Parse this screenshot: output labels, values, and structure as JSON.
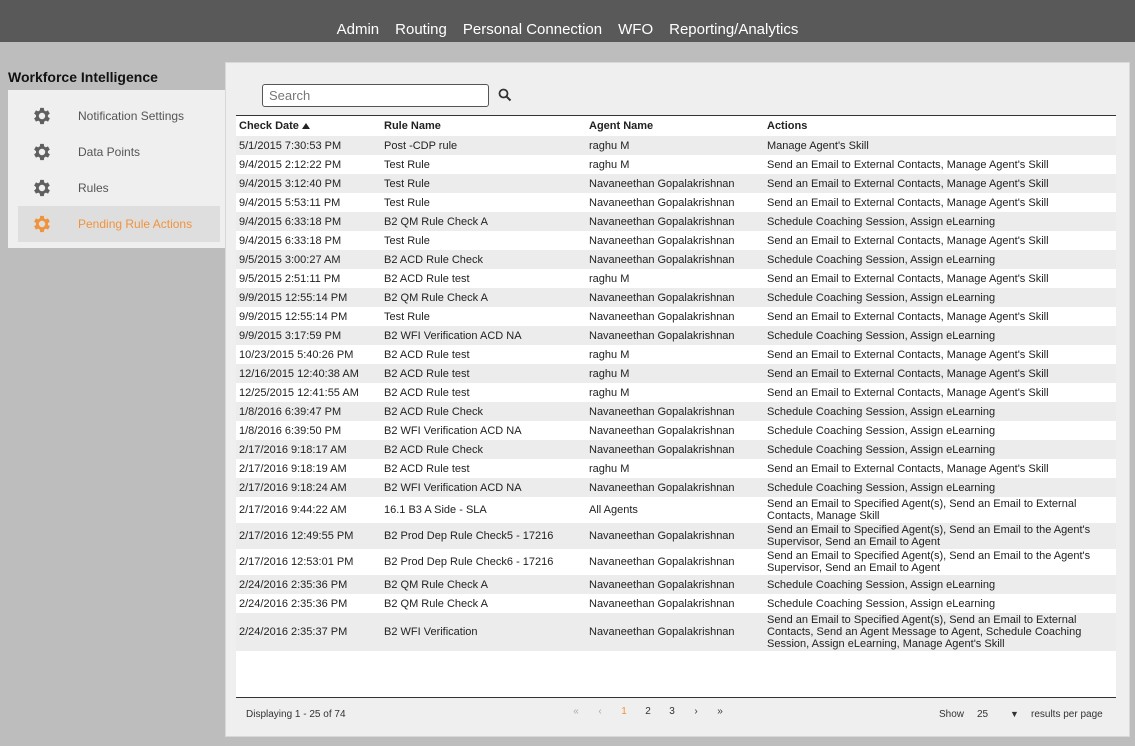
{
  "topnav": [
    "Admin",
    "Routing",
    "Personal Connection",
    "WFO",
    "Reporting/Analytics"
  ],
  "sidebar": {
    "title": "Workforce Intelligence",
    "items": [
      {
        "label": "Notification Settings",
        "icon": "gear-icon"
      },
      {
        "label": "Data Points",
        "icon": "gear-icon"
      },
      {
        "label": "Rules",
        "icon": "gear-icon"
      },
      {
        "label": "Pending Rule Actions",
        "icon": "gear-icon",
        "active": true
      }
    ]
  },
  "colors": {
    "accent": "#f0933f",
    "topbar": "#595959"
  },
  "search": {
    "placeholder": "Search",
    "icon": "magnifier-icon"
  },
  "table": {
    "columns": [
      "Check Date",
      "Rule Name",
      "Agent Name",
      "Actions"
    ],
    "sorted_by": "Check Date",
    "rows": [
      [
        "5/1/2015 7:30:53 PM",
        "Post -CDP rule",
        "raghu M",
        "Manage Agent's Skill"
      ],
      [
        "9/4/2015 2:12:22 PM",
        "Test Rule",
        "raghu M",
        "Send an Email to External Contacts, Manage Agent's Skill"
      ],
      [
        "9/4/2015 3:12:40 PM",
        "Test Rule",
        "Navaneethan Gopalakrishnan",
        "Send an Email to External Contacts, Manage Agent's Skill"
      ],
      [
        "9/4/2015 5:53:11 PM",
        "Test Rule",
        "Navaneethan Gopalakrishnan",
        "Send an Email to External Contacts, Manage Agent's Skill"
      ],
      [
        "9/4/2015 6:33:18 PM",
        "B2 QM Rule Check A",
        "Navaneethan Gopalakrishnan",
        "Schedule Coaching Session, Assign eLearning"
      ],
      [
        "9/4/2015 6:33:18 PM",
        "Test Rule",
        "Navaneethan Gopalakrishnan",
        "Send an Email to External Contacts, Manage Agent's Skill"
      ],
      [
        "9/5/2015 3:00:27 AM",
        "B2 ACD Rule Check",
        "Navaneethan Gopalakrishnan",
        "Schedule Coaching Session, Assign eLearning"
      ],
      [
        "9/5/2015 2:51:11 PM",
        "B2 ACD Rule test",
        "raghu M",
        "Send an Email to External Contacts, Manage Agent's Skill"
      ],
      [
        "9/9/2015 12:55:14 PM",
        "B2 QM Rule Check A",
        "Navaneethan Gopalakrishnan",
        "Schedule Coaching Session, Assign eLearning"
      ],
      [
        "9/9/2015 12:55:14 PM",
        "Test Rule",
        "Navaneethan Gopalakrishnan",
        "Send an Email to External Contacts, Manage Agent's Skill"
      ],
      [
        "9/9/2015 3:17:59 PM",
        "B2 WFI Verification ACD NA",
        "Navaneethan Gopalakrishnan",
        "Schedule Coaching Session, Assign eLearning"
      ],
      [
        "10/23/2015 5:40:26 PM",
        "B2 ACD Rule test",
        "raghu M",
        "Send an Email to External Contacts, Manage Agent's Skill"
      ],
      [
        "12/16/2015 12:40:38 AM",
        "B2 ACD Rule test",
        "raghu M",
        "Send an Email to External Contacts, Manage Agent's Skill"
      ],
      [
        "12/25/2015 12:41:55 AM",
        "B2 ACD Rule test",
        "raghu M",
        "Send an Email to External Contacts, Manage Agent's Skill"
      ],
      [
        "1/8/2016 6:39:47 PM",
        "B2 ACD Rule Check",
        "Navaneethan Gopalakrishnan",
        "Schedule Coaching Session, Assign eLearning"
      ],
      [
        "1/8/2016 6:39:50 PM",
        "B2 WFI Verification ACD NA",
        "Navaneethan Gopalakrishnan",
        "Schedule Coaching Session, Assign eLearning"
      ],
      [
        "2/17/2016 9:18:17 AM",
        "B2 ACD Rule Check",
        "Navaneethan Gopalakrishnan",
        "Schedule Coaching Session, Assign eLearning"
      ],
      [
        "2/17/2016 9:18:19 AM",
        "B2 ACD Rule test",
        "raghu M",
        "Send an Email to External Contacts, Manage Agent's Skill"
      ],
      [
        "2/17/2016 9:18:24 AM",
        "B2 WFI Verification ACD NA",
        "Navaneethan Gopalakrishnan",
        "Schedule Coaching Session, Assign eLearning"
      ],
      [
        "2/17/2016 9:44:22 AM",
        "16.1 B3 A Side - SLA",
        "All Agents",
        "Send an Email to Specified Agent(s), Send an Email to External Contacts, Manage Skill"
      ],
      [
        "2/17/2016 12:49:55 PM",
        "B2 Prod Dep Rule Check5 - 17216",
        "Navaneethan Gopalakrishnan",
        "Send an Email to Specified Agent(s), Send an Email to the Agent's Supervisor, Send an Email to Agent"
      ],
      [
        "2/17/2016 12:53:01 PM",
        "B2 Prod Dep Rule Check6 - 17216",
        "Navaneethan Gopalakrishnan",
        "Send an Email to Specified Agent(s), Send an Email to the Agent's Supervisor, Send an Email to Agent"
      ],
      [
        "2/24/2016 2:35:36 PM",
        "B2 QM Rule Check A",
        "Navaneethan Gopalakrishnan",
        "Schedule Coaching Session, Assign eLearning"
      ],
      [
        "2/24/2016 2:35:36 PM",
        "B2 QM Rule Check A",
        "Navaneethan Gopalakrishnan",
        "Schedule Coaching Session, Assign eLearning"
      ],
      [
        "2/24/2016 2:35:37 PM",
        "B2 WFI Verification",
        "Navaneethan Gopalakrishnan",
        "Send an Email to Specified Agent(s), Send an Email to External Contacts, Send an Agent Message to Agent, Schedule Coaching Session, Assign eLearning, Manage Agent's Skill"
      ]
    ]
  },
  "footer": {
    "displaying": "Displaying 1 - 25 of 74",
    "pager": {
      "first": "«",
      "prev": "‹",
      "pages": [
        "1",
        "2",
        "3"
      ],
      "current": "1",
      "next": "›",
      "last": "»"
    },
    "show_label": "Show",
    "page_size": "25",
    "page_size_suffix": "results per page"
  }
}
